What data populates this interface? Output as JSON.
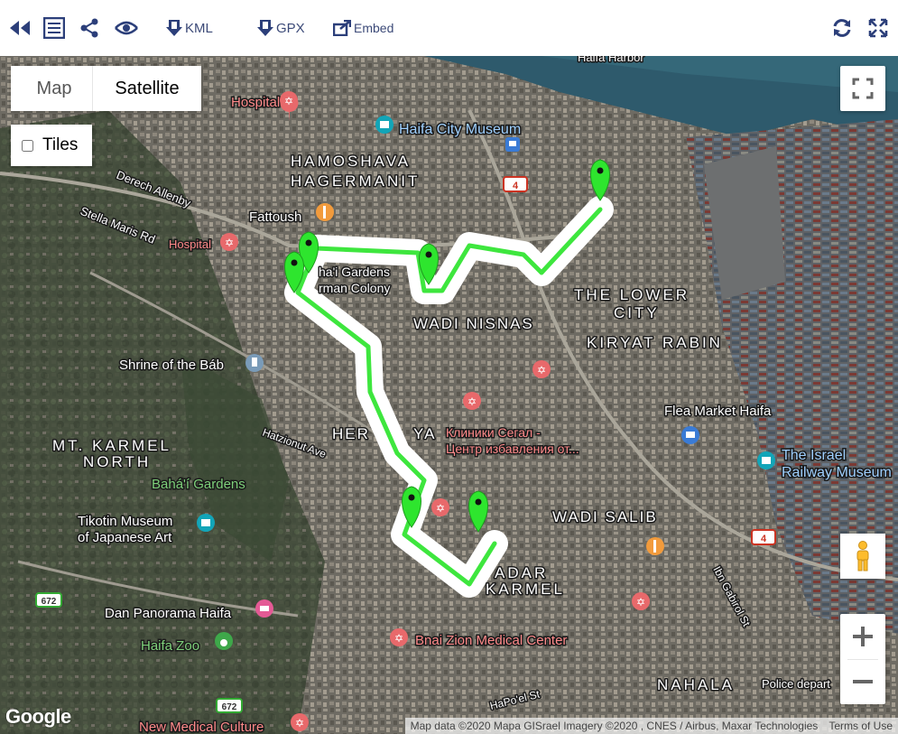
{
  "toolbar": {
    "kml_label": "KML",
    "gpx_label": "GPX",
    "embed_label": "Embed"
  },
  "controls": {
    "map_label": "Map",
    "satellite_label": "Satellite",
    "tiles_label": "Tiles",
    "selected_map_type": "Satellite",
    "tiles_checked": false
  },
  "map_labels": {
    "harbor": "Haifa Harbor",
    "hospital1": "Hospital",
    "city_museum": "Haifa City Museum",
    "hamoshava": "HAMOSHAVA",
    "hagermanit": "HAGERMANIT",
    "derech_allenby": "Derech Allenby",
    "stella_maris": "Stella Maris Rd",
    "fattoush": "Fattoush",
    "hospital2": "Hospital",
    "road4a": "4",
    "gardens": "ha'i Gardens",
    "colony": "rman Colony",
    "lower": "THE LOWER",
    "city": "CITY",
    "wadi_nisnas": "WADI NISNAS",
    "kiryat_rabin": "KIRYAT RABIN",
    "shrine": "Shrine of the Báb",
    "flea_market": "Flea Market Haifa",
    "her": "HER",
    "ya": "YA",
    "clinic1": "Клиники Сегал -",
    "clinic2": "Центр избавления от...",
    "hatzionut": "Hatzionut Ave",
    "mt_karmel": "MT. KARMEL",
    "north": "NORTH",
    "israel_railway1": "The Israel",
    "israel_railway2": "Railway Museum",
    "bahai_gardens": "Bahá'í Gardens",
    "tikotin1": "Tikotin Museum",
    "tikotin2": "of Japanese Art",
    "wadi_salib": "WADI SALIB",
    "road4b": "4",
    "hadar": "ADAR",
    "karmel": "KARMEL",
    "ibn_gabirol": "Ibn Gabirol St",
    "road672a": "672",
    "dan_panorama": "Dan Panorama Haifa",
    "haifa_zoo": "Haifa Zoo",
    "bnai_zion": "Bnai Zion Medical Center",
    "hapoel": "HaPo'el St",
    "nahala": "NAHALA",
    "police": "Police depart",
    "road672b": "672",
    "new_medical": "New Medical Culture",
    "google": "Google"
  },
  "attribution": {
    "map_data": "Map data ©2020 Mapa GISrael Imagery ©2020 , CNES / Airbus, Maxar Technologies",
    "terms": "Terms of Use"
  },
  "route": {
    "color": "#3ee63e",
    "casing_color": "#ffffff",
    "marker_color": "#2ee52e",
    "marker_count": 7
  },
  "icons": {
    "back": "rewind-icon",
    "list": "list-icon",
    "share": "share-icon",
    "view": "eye-icon",
    "kml": "download-icon",
    "gpx": "download-icon",
    "embed": "embed-icon",
    "refresh": "refresh-icon",
    "expand": "expand-icon"
  }
}
